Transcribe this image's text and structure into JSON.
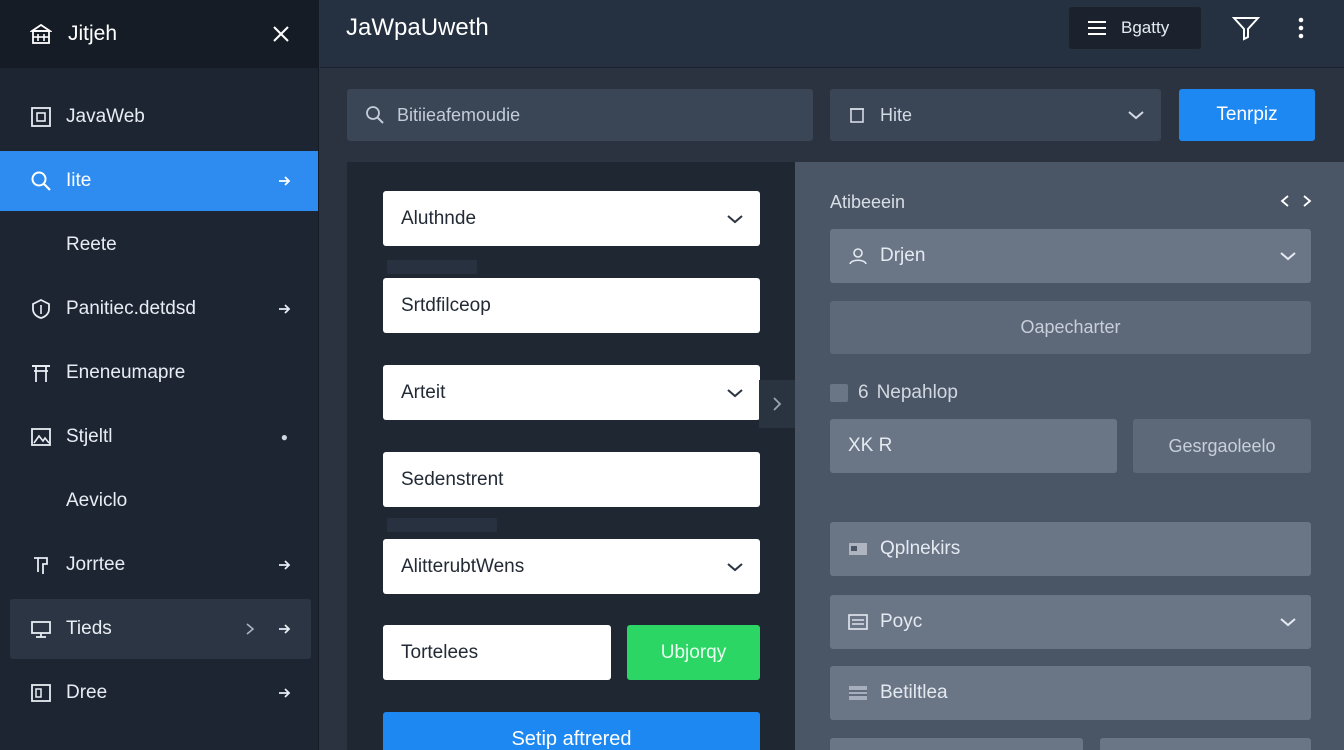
{
  "sidebar": {
    "title": "Jitjeh",
    "items": [
      {
        "label": "JavaWeb",
        "icon": "app-window-icon",
        "arrow": false,
        "state": "normal"
      },
      {
        "label": "Iite",
        "icon": "search-icon",
        "arrow": true,
        "state": "active"
      },
      {
        "label": "Reete",
        "icon": "",
        "arrow": false,
        "state": "indent"
      },
      {
        "label": "Panitiec.detdsd",
        "icon": "shield-icon",
        "arrow": true,
        "state": "normal"
      },
      {
        "label": "Eneneumapre",
        "icon": "gate-icon",
        "arrow": false,
        "state": "normal"
      },
      {
        "label": "Stjeltl",
        "icon": "image-icon",
        "arrow": false,
        "state": "normal"
      },
      {
        "label": "Aeviclo",
        "icon": "",
        "arrow": false,
        "state": "indent"
      },
      {
        "label": "Jorrtee",
        "icon": "bracket-icon",
        "arrow": true,
        "state": "normal"
      },
      {
        "label": "Tieds",
        "icon": "monitor-icon",
        "arrow": true,
        "state": "hover"
      },
      {
        "label": "Dree",
        "icon": "panel-icon",
        "arrow": true,
        "state": "normal"
      }
    ]
  },
  "topbar": {
    "app_title": "JaWpaUweth",
    "filter_label": "Bgatty"
  },
  "toolbar": {
    "search_placeholder": "Bitiieafemoudie",
    "select_label": "Hite",
    "primary_label": "Tenrpiz"
  },
  "form": {
    "fields": [
      {
        "label": "Aluthnde",
        "dropdown": true
      },
      {
        "label": "Srtdfilceop",
        "dropdown": false
      },
      {
        "label": "Arteit",
        "dropdown": true
      },
      {
        "label": "Sedenstrent",
        "dropdown": false
      },
      {
        "label": "AlitterubtWens",
        "dropdown": true
      },
      {
        "label": "Tortelees",
        "dropdown": false
      }
    ],
    "green_label": "Ubjorqy",
    "submit_label": "Setip aftrered"
  },
  "settings": {
    "title": "Atibeeein",
    "fields": [
      {
        "label": "Drjen",
        "icon": "user-icon",
        "dropdown": true
      },
      {
        "label": "Qplnekirs",
        "icon": "card-icon",
        "dropdown": false
      },
      {
        "label": "Poyc",
        "icon": "list-icon",
        "dropdown": true
      },
      {
        "label": "Betiltlea",
        "icon": "table-icon",
        "dropdown": false
      }
    ],
    "button_label": "Oapecharter",
    "check_num": "6",
    "check_label": "Nepahlop",
    "input_value": "XK R",
    "side_button_label": "Gesrgaoleelo"
  },
  "colors": {
    "accent": "#1e88f2",
    "success": "#2bd665",
    "sidebar_bg": "#1d2532"
  }
}
